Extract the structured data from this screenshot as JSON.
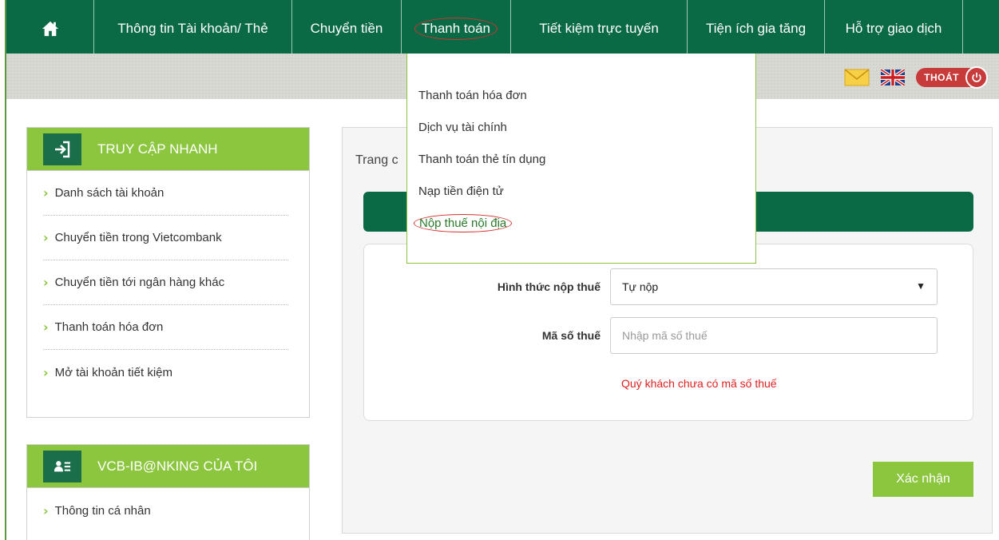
{
  "nav": {
    "home_icon": "home-icon",
    "items": [
      {
        "label": "Thông tin Tài khoản/ Thẻ"
      },
      {
        "label": "Chuyển tiền"
      },
      {
        "label": "Thanh toán"
      },
      {
        "label": "Tiết kiệm trực tuyến"
      },
      {
        "label": "Tiện ích gia tăng"
      },
      {
        "label": "Hỗ trợ giao dịch"
      }
    ]
  },
  "header_tools": {
    "mail_icon": "mail-icon",
    "language_icon": "uk-flag-icon",
    "logout_label": "THOÁT",
    "logout_icon": "power-icon"
  },
  "dropdown": {
    "items": [
      {
        "label": "Thanh toán hóa đơn"
      },
      {
        "label": "Dịch vụ tài chính"
      },
      {
        "label": "Thanh toán thẻ tín dụng"
      },
      {
        "label": "Nạp tiền điện tử"
      },
      {
        "label": "Nộp thuế nội địa"
      }
    ]
  },
  "quick_access": {
    "title": "TRUY CẬP NHANH",
    "icon": "sign-in-icon",
    "items": [
      {
        "label": "Danh sách tài khoản"
      },
      {
        "label": "Chuyển tiền trong Vietcombank"
      },
      {
        "label": "Chuyển tiền tới ngân hàng khác"
      },
      {
        "label": "Thanh toán hóa đơn"
      },
      {
        "label": "Mở tài khoản tiết kiệm"
      }
    ]
  },
  "my_banking": {
    "title": "VCB-IB@NKING CỦA TÔI",
    "icon": "user-card-icon",
    "items": [
      {
        "label": "Thông tin cá nhân"
      }
    ]
  },
  "main": {
    "breadcrumb": "Trang c",
    "form": {
      "method_label": "Hình thức nộp thuế",
      "method_value": "Tự nộp",
      "tax_code_label": "Mã số thuế",
      "tax_code_placeholder": "Nhập mã số thuế",
      "warning": "Quý khách chưa có mã số thuế"
    },
    "confirm_label": "Xác nhận"
  },
  "colors": {
    "brand_dark_green": "#0a6a45",
    "brand_light_green": "#8cc63f",
    "warning_red": "#e02020",
    "logout_red": "#c73b3b"
  }
}
